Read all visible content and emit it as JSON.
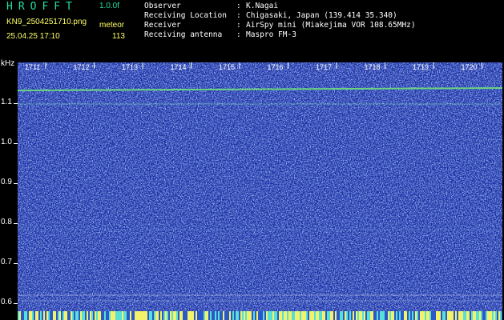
{
  "header": {
    "app_title": "HROFFT",
    "app_version": "1.0.0f",
    "file_name": "KN9_2504251710.png",
    "mode": "meteor",
    "datetime": "25.04.25 17:10",
    "count": "113"
  },
  "info": [
    {
      "label": "Observer",
      "value": "K.Nagai"
    },
    {
      "label": "Receiving Location",
      "value": "Chigasaki, Japan (139.414 35.340)"
    },
    {
      "label": "Receiver",
      "value": "AirSpy mini (Miakejima VOR 108.65MHz)"
    },
    {
      "label": "Receiving antenna",
      "value": "Maspro FM-3"
    }
  ],
  "yaxis": {
    "unit": "kHz",
    "ticks": [
      "1.1",
      "1.0",
      "0.9",
      "0.8",
      "0.7",
      "0.6"
    ]
  },
  "time_ticks": [
    "1711",
    "1712",
    "1713",
    "1714",
    "1715",
    "1716",
    "1717",
    "1718",
    "1719",
    "1720"
  ],
  "colors": {
    "background": "#1b2a9e",
    "title": "#22e0a0",
    "meta": "#ffff66",
    "signal": "#6fe27a"
  }
}
